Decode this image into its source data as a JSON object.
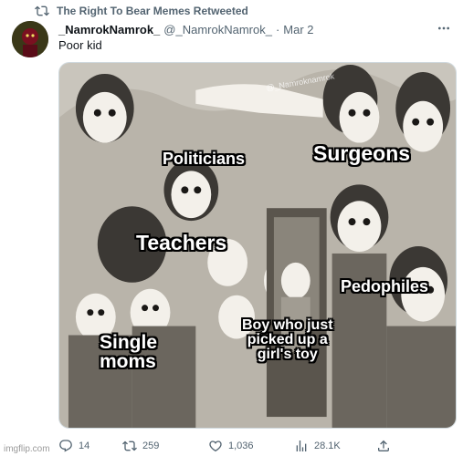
{
  "retweet": {
    "label": "The Right To Bear Memes Retweeted",
    "icon": "retweet-icon"
  },
  "tweet": {
    "display_name": "_NamrokNamrok_",
    "handle": "@_NamrokNamrok_",
    "separator": "·",
    "date": "Mar 2",
    "text": "Poor kid"
  },
  "media": {
    "watermark": "@_Namroknamrok",
    "labels": {
      "politicians": "Politicians",
      "surgeons": "Surgeons",
      "teachers": "Teachers",
      "pedophiles": "Pedophiles",
      "single_moms": "Single\nmoms",
      "boy": "Boy who just\npicked up a\ngirl's toy"
    }
  },
  "actions": {
    "replies": "14",
    "retweets": "259",
    "likes": "1,036",
    "views": "28.1K"
  },
  "footer": {
    "site_watermark": "imgflip.com"
  },
  "colors": {
    "muted": "#536471",
    "text": "#0f1419",
    "border": "#cfd9de"
  }
}
